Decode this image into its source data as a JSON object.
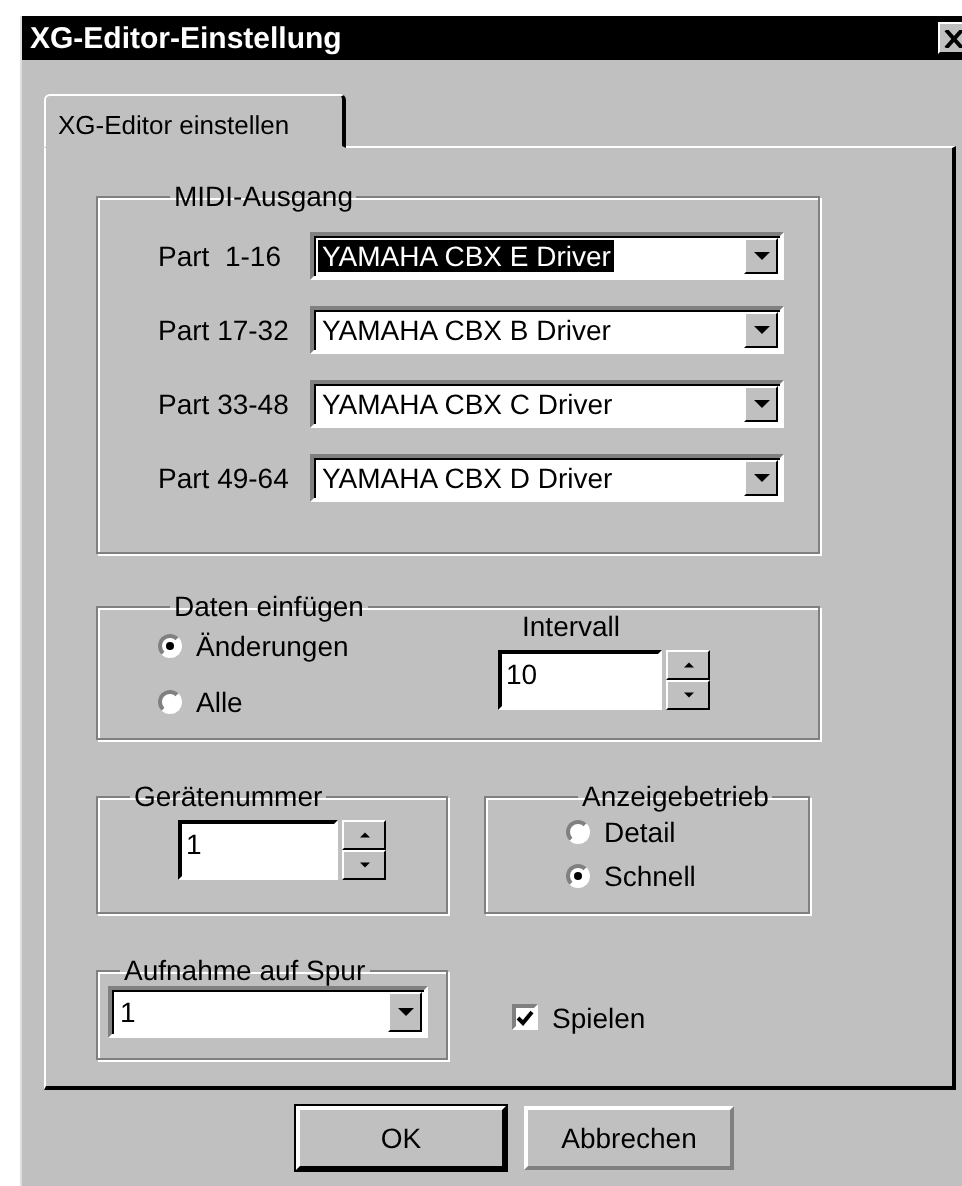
{
  "window": {
    "title": "XG-Editor-Einstellung"
  },
  "tabs": [
    {
      "label": "XG-Editor einstellen",
      "selected": true
    }
  ],
  "midi_output": {
    "title": "MIDI-Ausgang",
    "rows": [
      {
        "label": "Part  1-16",
        "value": "YAMAHA CBX E Driver",
        "focused": true
      },
      {
        "label": "Part 17-32",
        "value": "YAMAHA CBX B Driver",
        "focused": false
      },
      {
        "label": "Part 33-48",
        "value": "YAMAHA CBX C Driver",
        "focused": false
      },
      {
        "label": "Part 49-64",
        "value": "YAMAHA CBX D Driver",
        "focused": false
      }
    ]
  },
  "insert_data": {
    "title": "Daten einfügen",
    "options": [
      {
        "label": "Änderungen",
        "selected": true
      },
      {
        "label": "Alle",
        "selected": false
      }
    ],
    "interval": {
      "label": "Intervall",
      "value": "10"
    }
  },
  "device_number": {
    "title": "Gerätenummer",
    "value": "1"
  },
  "display_mode": {
    "title": "Anzeigebetrieb",
    "options": [
      {
        "label": "Detail",
        "selected": false
      },
      {
        "label": "Schnell",
        "selected": true
      }
    ]
  },
  "record_track": {
    "title": "Aufnahme auf Spur",
    "value": "1"
  },
  "play": {
    "label": "Spielen",
    "checked": true
  },
  "buttons": [
    {
      "label": "OK",
      "default": true
    },
    {
      "label": "Abbrechen",
      "default": false
    }
  ]
}
